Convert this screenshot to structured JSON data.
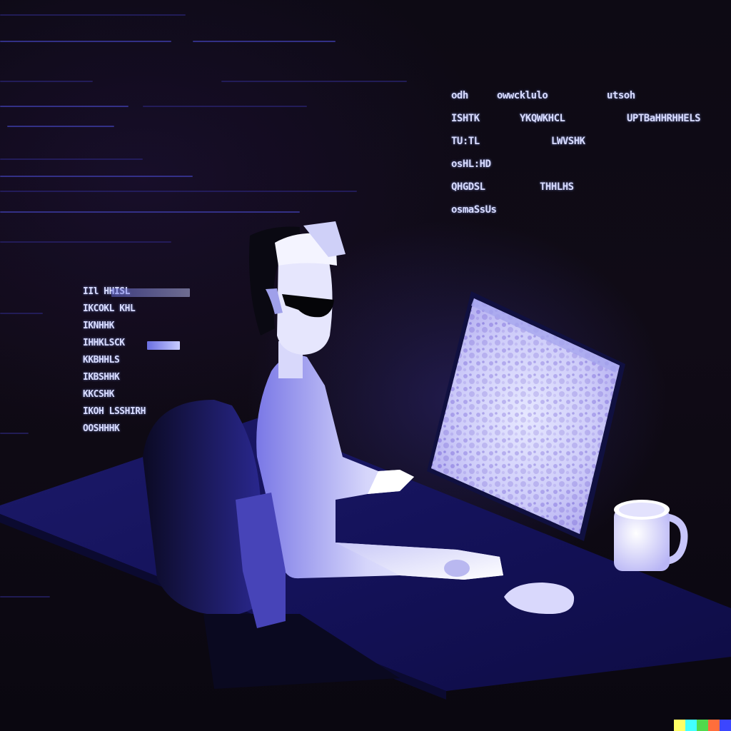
{
  "scene": {
    "subject": "person in cap and sunglasses at desk facing glowing monitor",
    "palette": {
      "background": "#0c0810",
      "glow": "#4a44d8",
      "highlight": "#eef0ff",
      "desk": "#17165a"
    }
  },
  "hud_right": {
    "rows": [
      [
        "odh",
        "owwcklulo",
        "utsoh"
      ],
      [
        "ISHTK",
        "YKQWKHCL",
        "UPTBaHHRHHELS"
      ],
      [
        "TU:TL",
        "LWVSHK"
      ],
      [
        "osHL:HD"
      ],
      [
        "QHGDSL",
        "THHLHS"
      ],
      [
        "osmaSsUs"
      ]
    ]
  },
  "hud_left": {
    "rows": [
      "IIl HHISL",
      "IKCOKL KHL",
      "IKNHHK",
      "IHHKLSCK",
      "KKBHHLS",
      "IKBSHHK",
      "KKCSHK",
      "IKOH LSSHIRH",
      "OOSHHHK"
    ]
  },
  "logo": {
    "colors": [
      "#ffff66",
      "#42ffff",
      "#51da4c",
      "#ff6e3c",
      "#3c46ff"
    ]
  }
}
